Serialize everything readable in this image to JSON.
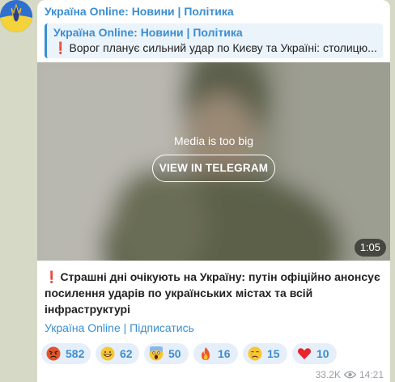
{
  "message": {
    "channel_name": "Україна Online: Новини | Політика",
    "reply": {
      "title": "Україна Online: Новини | Політика",
      "text": "Ворог планує сильний удар по Києву та Україні: столицю..."
    },
    "media": {
      "notice": "Media is too big",
      "view_button": "VIEW IN TELEGRAM",
      "duration": "1:05"
    },
    "text": "Страшні дні очікують на Україну: путін офіційно анонсує посилення ударів по українських містах та всій інфраструктурі",
    "subscribe_link": "Україна Online | Підписатись",
    "reactions": [
      {
        "icon": "angry-face-icon",
        "count": "582"
      },
      {
        "icon": "grinning-face-icon",
        "count": "62"
      },
      {
        "icon": "screaming-face-icon",
        "count": "50"
      },
      {
        "icon": "fire-icon",
        "count": "16"
      },
      {
        "icon": "crying-face-icon",
        "count": "15"
      },
      {
        "icon": "red-heart-icon",
        "count": "10"
      }
    ],
    "views": "33.2K",
    "time": "14:21"
  },
  "colors": {
    "accent": "#3a8ed1",
    "background": "#d5d9c5",
    "reaction_bg": "#e6eff9"
  }
}
